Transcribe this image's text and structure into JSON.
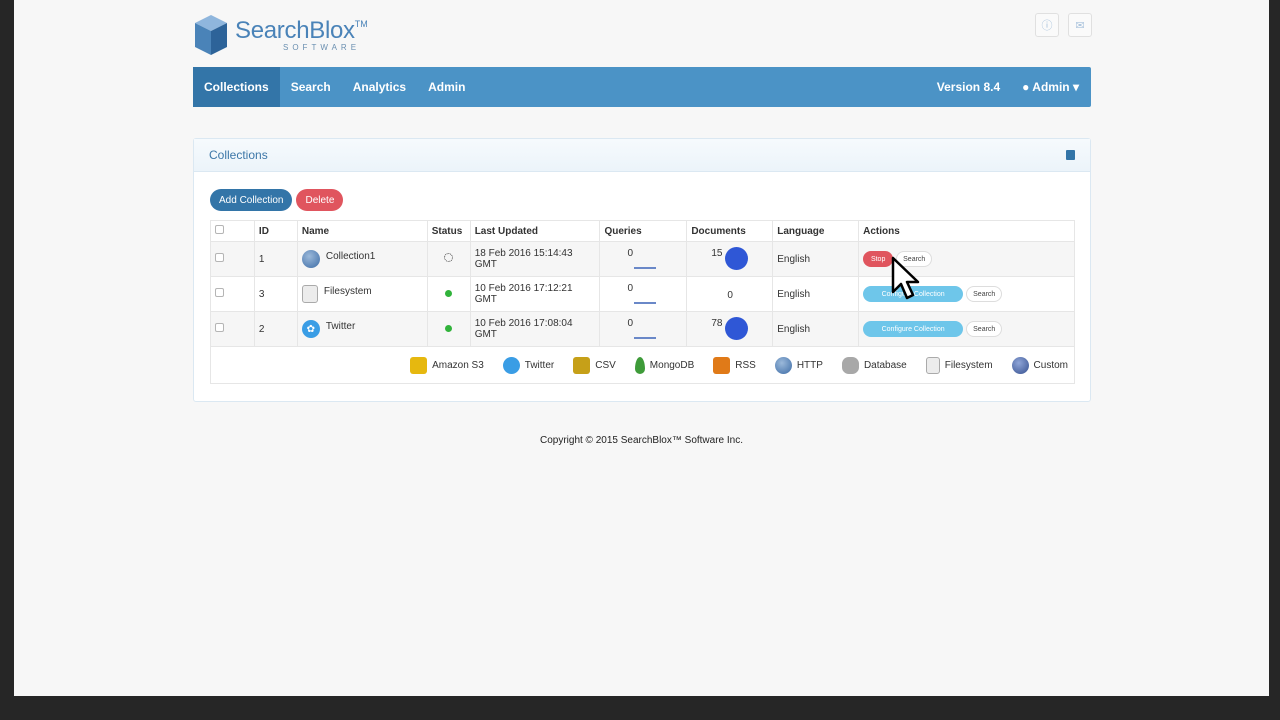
{
  "brand": {
    "name": "SearchBlox",
    "tm": "TM",
    "sub": "SOFTWARE"
  },
  "header_icons": [
    {
      "icon": "info-icon",
      "glyph": "ⓘ"
    },
    {
      "icon": "mail-icon",
      "glyph": "✉"
    }
  ],
  "nav": {
    "items": [
      "Collections",
      "Search",
      "Analytics",
      "Admin"
    ],
    "active": "Collections",
    "version": "Version 8.4",
    "user": "Admin"
  },
  "panel": {
    "title": "Collections",
    "buttons": {
      "add": "Add Collection",
      "delete": "Delete"
    }
  },
  "table": {
    "headers": [
      "ID",
      "Name",
      "Status",
      "Last Updated",
      "Queries",
      "Documents",
      "Language",
      "Actions"
    ],
    "rows": [
      {
        "id": "1",
        "name": "Collection1",
        "type_icon": "http-globe-icon",
        "status": "indexing",
        "last_updated": "18 Feb 2016 15:14:43 GMT",
        "queries": "0",
        "documents": "15",
        "language": "English",
        "primary_action": "Stop",
        "secondary_action": "Search"
      },
      {
        "id": "3",
        "name": "Filesystem",
        "type_icon": "filesystem-icon",
        "status": "idle",
        "last_updated": "10 Feb 2016 17:12:21 GMT",
        "queries": "0",
        "documents": "0",
        "language": "English",
        "primary_action": "Configure Collection",
        "secondary_action": "Search"
      },
      {
        "id": "2",
        "name": "Twitter",
        "type_icon": "twitter-icon",
        "status": "idle",
        "last_updated": "10 Feb 2016 17:08:04 GMT",
        "queries": "0",
        "documents": "78",
        "language": "English",
        "primary_action": "Configure Collection",
        "secondary_action": "Search"
      }
    ]
  },
  "sources": [
    "Amazon S3",
    "Twitter",
    "CSV",
    "MongoDB",
    "RSS",
    "HTTP",
    "Database",
    "Filesystem",
    "Custom"
  ],
  "footer": {
    "copyright": "Copyright © 2015 SearchBlox™ Software Inc."
  },
  "colors": {
    "nav": "#4b93c6",
    "nav_active": "#3375a8",
    "danger": "#e0555e",
    "configure": "#6ec6ea",
    "documents_ball": "#2f57d6",
    "status_green": "#31b33b"
  }
}
